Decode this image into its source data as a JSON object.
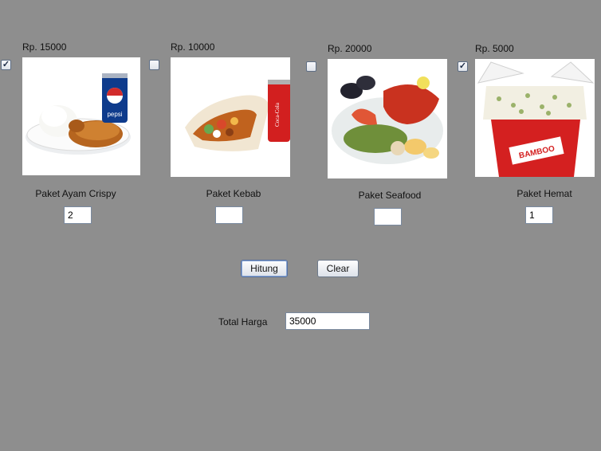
{
  "items": [
    {
      "price": "Rp. 15000",
      "name": "Paket Ayam Crispy",
      "qty": "2",
      "checked": true,
      "image": "fried-chicken-pepsi"
    },
    {
      "price": "Rp. 10000",
      "name": "Paket Kebab",
      "qty": "",
      "checked": false,
      "image": "kebab-coca-cola"
    },
    {
      "price": "Rp. 20000",
      "name": "Paket Seafood",
      "qty": "",
      "checked": false,
      "image": "seafood-platter"
    },
    {
      "price": "Rp. 5000",
      "name": "Paket Hemat",
      "qty": "1",
      "checked": true,
      "image": "rice-box"
    }
  ],
  "buttons": {
    "hitung": "Hitung",
    "clear": "Clear"
  },
  "total": {
    "label": "Total Harga",
    "value": "35000"
  },
  "image_text": {
    "pepsi": "pepsi",
    "coca_cola": "Coca-Cola",
    "bamboo": "BAMBOO"
  }
}
